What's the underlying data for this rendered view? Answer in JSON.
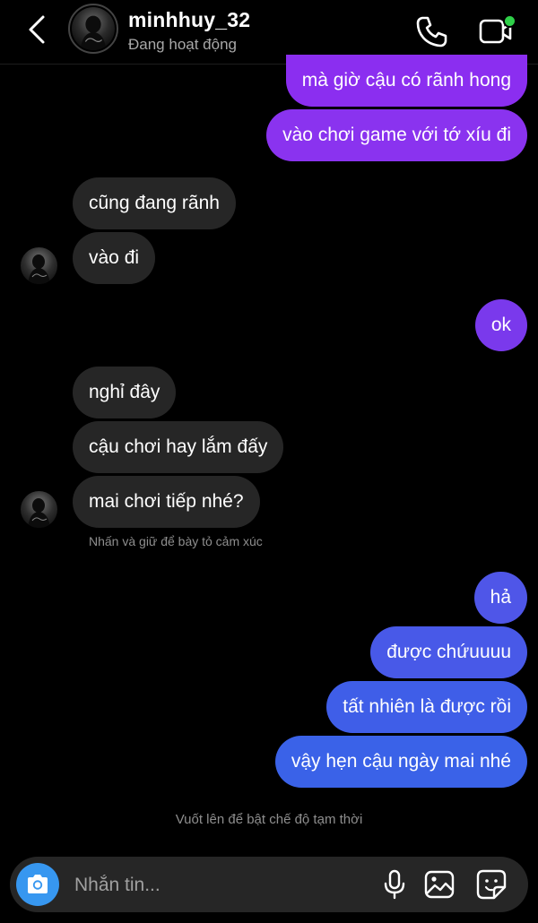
{
  "header": {
    "username": "minhhuy_32",
    "status": "Đang hoạt động",
    "online_dot_color": "#2fd049"
  },
  "messages": [
    {
      "side": "out",
      "text": "mà giờ cậu có rãnh hong",
      "color": "#8b2ef0"
    },
    {
      "side": "out",
      "text": "vào chơi game với tớ xíu đi",
      "color": "#8a33ef"
    },
    {
      "side": "in",
      "text": "cũng đang rãnh"
    },
    {
      "side": "in",
      "text": "vào đi"
    },
    {
      "side": "out",
      "text": "ok",
      "color": "#7a39ec"
    },
    {
      "side": "in",
      "text": "nghỉ đây"
    },
    {
      "side": "in",
      "text": "cậu chơi hay lắm đấy"
    },
    {
      "side": "in",
      "text": "mai chơi tiếp nhé?"
    },
    {
      "side": "out",
      "text": "hả",
      "color": "#4f56e8"
    },
    {
      "side": "out",
      "text": "được chứuuuu",
      "color": "#4859e8"
    },
    {
      "side": "out",
      "text": "tất nhiên là được rồi",
      "color": "#3f5ee8"
    },
    {
      "side": "out",
      "text": "vậy hẹn cậu ngày mai nhé",
      "color": "#3a62e8"
    }
  ],
  "reaction_hint": "Nhấn và giữ để bày tỏ cảm xúc",
  "vanish_hint": "Vuốt lên để bật chế độ tạm thời",
  "composer": {
    "placeholder": "Nhắn tin...",
    "camera_color": "#3797f0"
  },
  "icons": {
    "back": "chevron-left-icon",
    "call": "phone-icon",
    "video": "video-camera-icon",
    "camera": "camera-icon",
    "mic": "microphone-icon",
    "gallery": "image-icon",
    "sticker": "sticker-icon"
  }
}
